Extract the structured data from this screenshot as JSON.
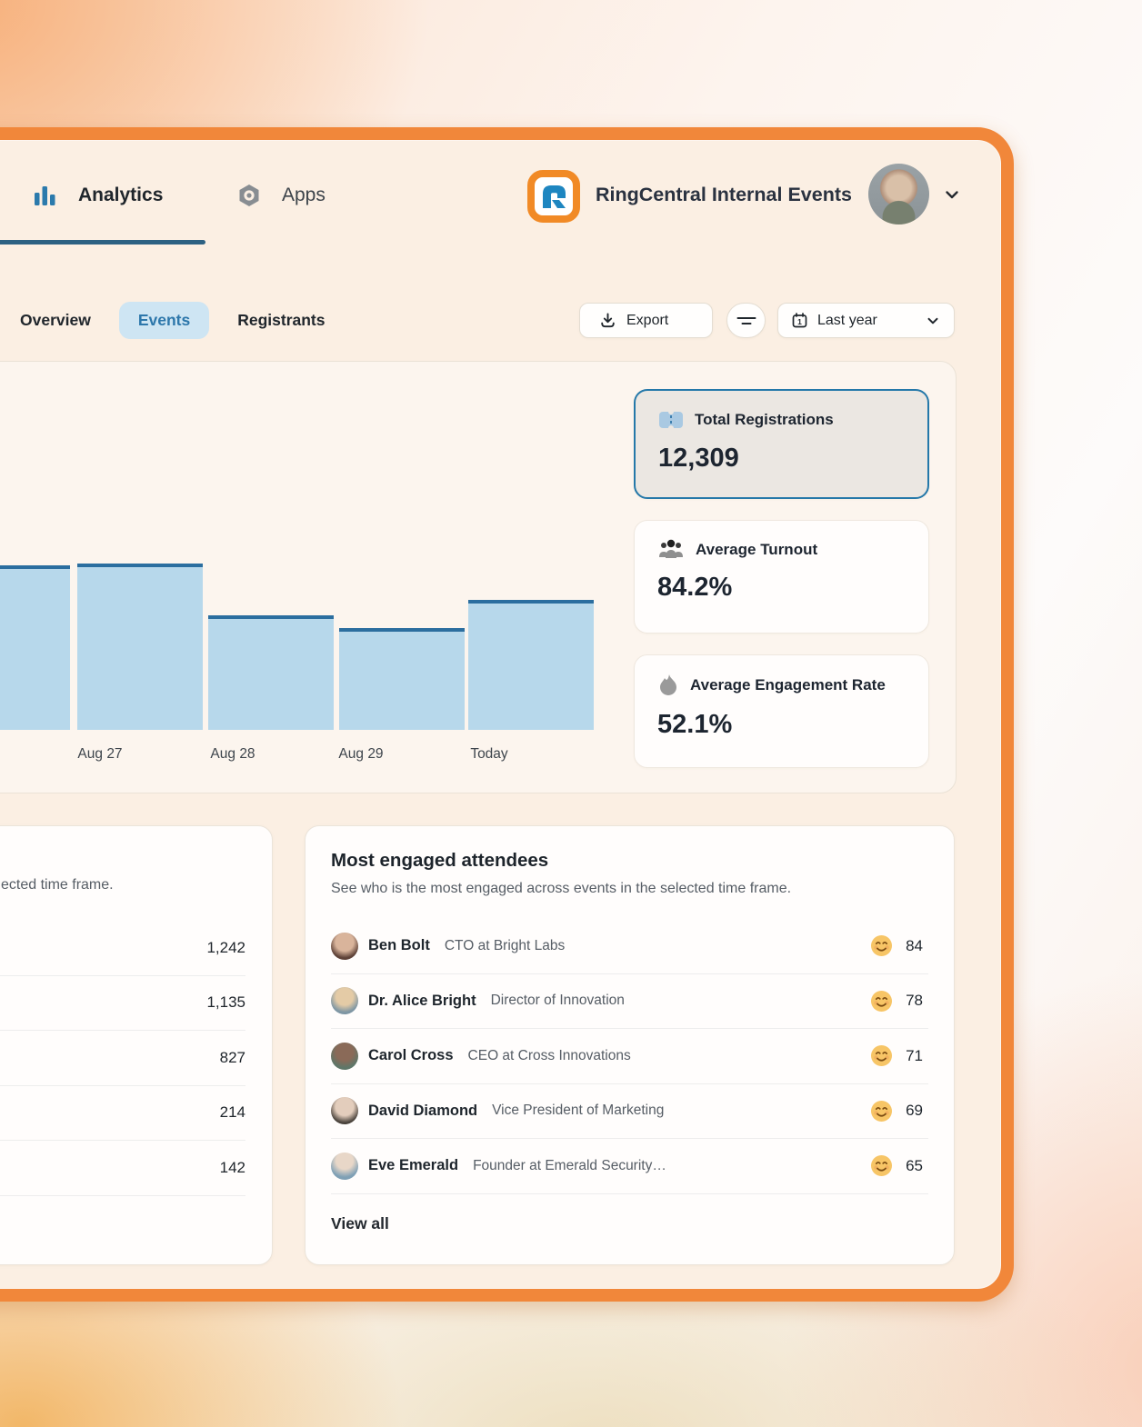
{
  "header": {
    "nav": [
      {
        "label": "Analytics",
        "active": true,
        "icon": "bar-chart-icon"
      },
      {
        "label": "Apps",
        "active": false,
        "icon": "hexagon-nut-icon"
      }
    ],
    "org_title": "RingCentral Internal Events",
    "logo": "ringcentral-logo",
    "avatar": "user-avatar",
    "chevron": "chevron-down-icon"
  },
  "toolbar": {
    "tabs": [
      {
        "label": "Overview",
        "active": false
      },
      {
        "label": "Events",
        "active": true
      },
      {
        "label": "Registrants",
        "active": false
      }
    ],
    "export_label": "Export",
    "filter_icon": "filter-lines-icon",
    "date_range_label": "Last year",
    "calendar_digit": "1"
  },
  "stats": [
    {
      "label": "Total Registrations",
      "value": "12,309",
      "icon": "ticket-icon",
      "selected": true
    },
    {
      "label": "Average Turnout",
      "value": "84.2%",
      "icon": "people-icon",
      "selected": false
    },
    {
      "label": "Average Engagement Rate",
      "value": "52.1%",
      "icon": "flame-icon",
      "selected": false
    }
  ],
  "chart_data": {
    "type": "bar",
    "categories": [
      "",
      "Aug 27",
      "Aug 28",
      "Aug 29",
      "Today"
    ],
    "values_norm": [
      0.99,
      1.0,
      0.69,
      0.61,
      0.78
    ],
    "ylim": [
      0,
      1
    ],
    "y_axis_visible": false,
    "grid": false,
    "first_bar_clipped_left": true,
    "bar_fill": "#b7d8eb",
    "bar_stroke": "#2b6e9f"
  },
  "left_card": {
    "subtitle_visible_fragment": "ected time frame.",
    "values": [
      "1,242",
      "1,135",
      "827",
      "214",
      "142"
    ]
  },
  "engaged_card": {
    "title": "Most engaged attendees",
    "subtitle": "See who is the most engaged across events in the selected time frame.",
    "attendees": [
      {
        "name": "Ben Bolt",
        "role": "CTO at Bright Labs",
        "score": "84"
      },
      {
        "name": "Dr. Alice Bright",
        "role": "Director of Innovation",
        "score": "78"
      },
      {
        "name": "Carol Cross",
        "role": "CEO at Cross Innovations",
        "score": "71"
      },
      {
        "name": "David Diamond",
        "role": "Vice President of Marketing",
        "score": "69"
      },
      {
        "name": "Eve Emerald",
        "role": "Founder at Emerald Security…",
        "score": "65"
      }
    ],
    "score_icon": "smiley-face-icon",
    "view_all_label": "View all"
  },
  "colors": {
    "accent_blue": "#2b76a9",
    "window_border_orange": "#f1873a",
    "window_bg": "#fbefe3",
    "bar_fill": "#b7d8eb",
    "bar_stroke": "#2b6e9f",
    "events_pill_bg": "#cee5f3",
    "selected_card_bg": "#ebe7e2",
    "selected_card_border": "#2478a9"
  }
}
